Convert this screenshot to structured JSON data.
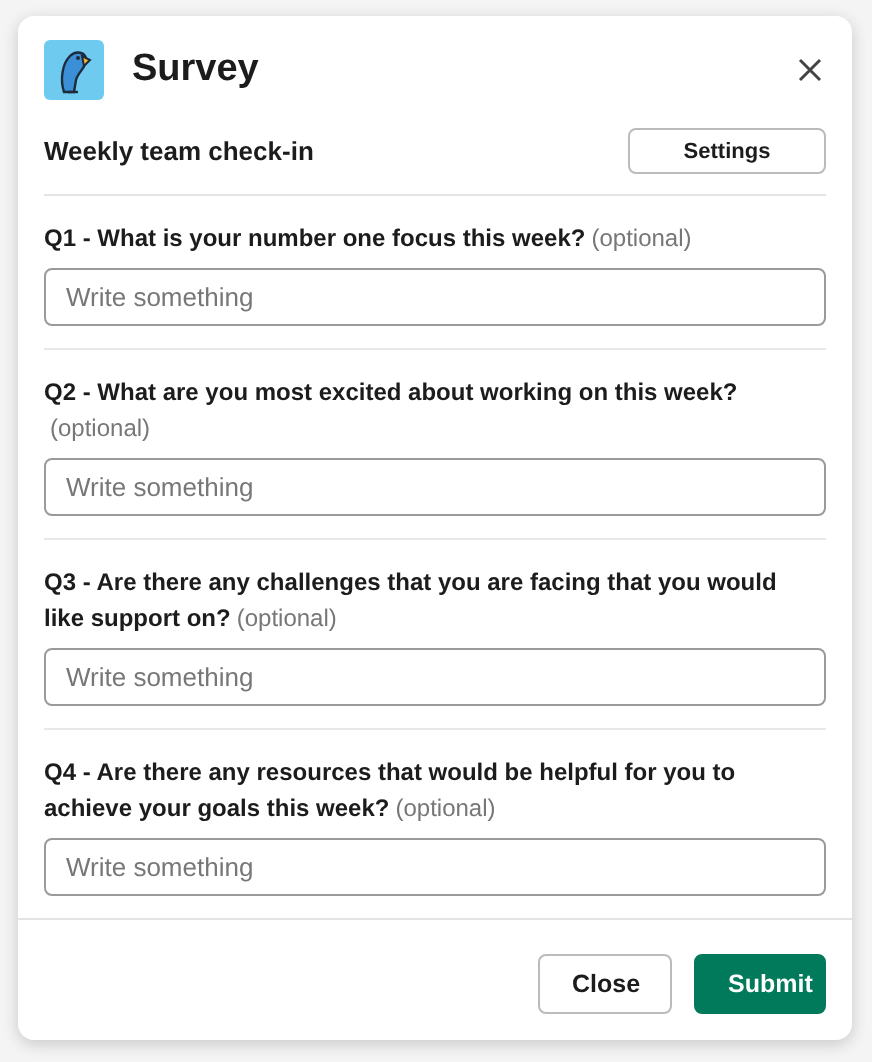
{
  "modal": {
    "title": "Survey",
    "subtitle": "Weekly team check-in",
    "settings_button": "Settings"
  },
  "questions": [
    {
      "label": "Q1 - What is your number one focus this week?",
      "hint": "(optional)",
      "placeholder": "Write something"
    },
    {
      "label": "Q2 - What are you most excited about working on this week?",
      "hint": "(optional)",
      "placeholder": "Write something"
    },
    {
      "label": "Q3 - Are there any challenges that you are facing that you would like support on?",
      "hint": "(optional)",
      "placeholder": "Write something"
    },
    {
      "label": "Q4 - Are there any resources that would be helpful for you to achieve your goals this week?",
      "hint": "(optional)",
      "placeholder": "Write something"
    }
  ],
  "buttons": [
    {
      "label": "Close",
      "kind": "secondary"
    },
    {
      "label": "Submit",
      "kind": "primary"
    }
  ]
}
